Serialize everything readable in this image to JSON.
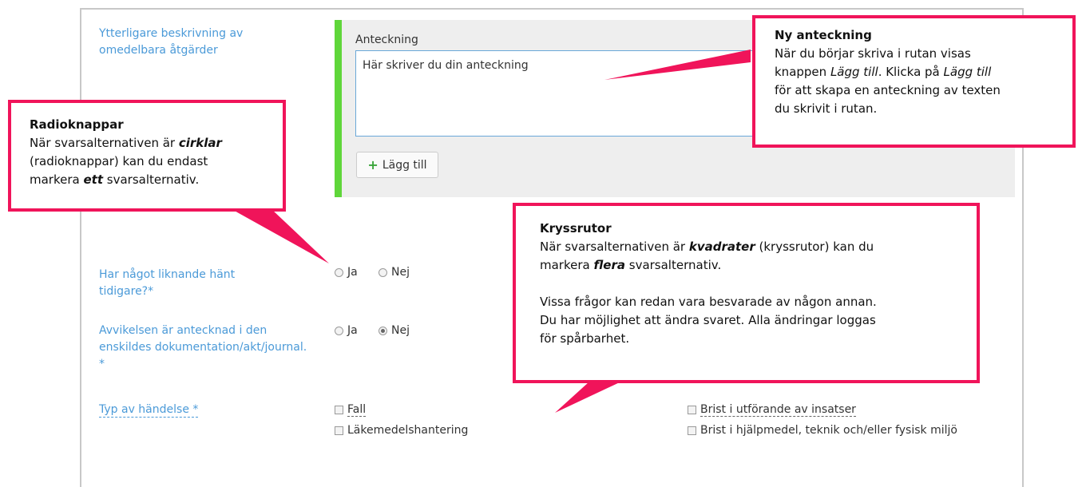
{
  "form": {
    "desc_label": "Ytterligare beskrivning av omedelbara åtgärder",
    "note": {
      "label": "Anteckning",
      "value": "Här skriver du din anteckning",
      "add_button": "Lägg till"
    },
    "q1": {
      "label": "Har något liknande hänt tidigare?*",
      "opt_yes": "Ja",
      "opt_no": "Nej",
      "selected": "none"
    },
    "q2": {
      "label": "Avvikelsen är antecknad i den enskildes dokumentation/akt/journal. *",
      "opt_yes": "Ja",
      "opt_no": "Nej",
      "selected": "Nej"
    },
    "q3": {
      "label": "Typ av händelse *",
      "options_left": [
        "Fall",
        "Läkemedelshantering"
      ],
      "options_right": [
        "Brist i utförande av insatser",
        "Brist i hjälpmedel, teknik och/eller fysisk miljö"
      ]
    }
  },
  "callouts": {
    "new_note": {
      "title": "Ny anteckning",
      "l1": "När du börjar skriva i rutan visas",
      "l2a": "knappen ",
      "l2b": "Lägg till",
      "l2c": ". Klicka på ",
      "l2d": "Lägg till",
      "l3": "för att skapa en anteckning av texten",
      "l4": "du skrivit i rutan."
    },
    "radio": {
      "title": "Radioknappar",
      "l1a": "När svarsalternativen är ",
      "l1b": "cirklar",
      "l2": "(radioknappar) kan du endast",
      "l3a": "markera ",
      "l3b": "ett",
      "l3c": " svarsalternativ."
    },
    "checkbox": {
      "title": "Kryssrutor",
      "l1a": "När svarsalternativen är ",
      "l1b": "kvadrater",
      "l1c": " (kryssrutor) kan du",
      "l2a": "markera ",
      "l2b": "flera",
      "l2c": " svarsalternativ.",
      "l3": "Vissa frågor kan redan vara besvarade av någon annan.",
      "l4": "Du har möjlighet att ändra svaret. Alla ändringar loggas",
      "l5": "för spårbarhet."
    }
  },
  "colors": {
    "accent": "#f0145a",
    "label_blue": "#4b9ad8",
    "green_bar": "#5fd63a",
    "panel_bg": "#eeeeee"
  }
}
